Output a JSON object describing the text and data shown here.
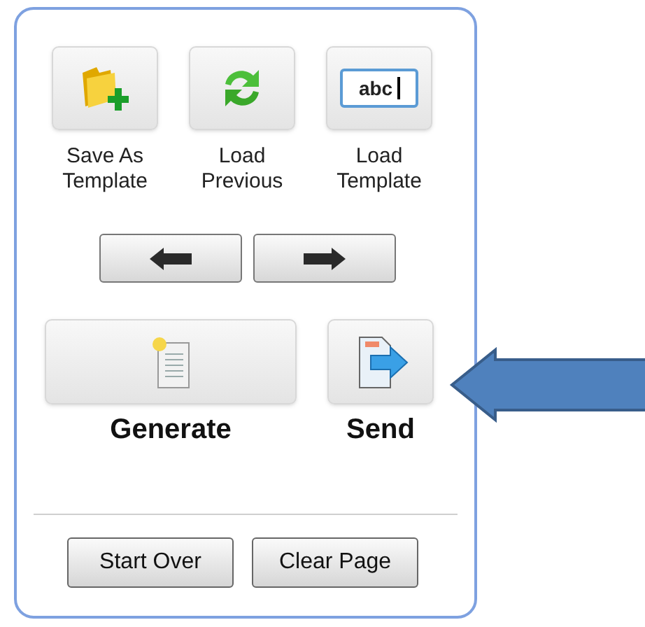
{
  "tiles": [
    {
      "kind": "folder",
      "label": "Save As Template"
    },
    {
      "kind": "reload",
      "label": "Load Previous"
    },
    {
      "kind": "textbox",
      "label": "Load Template",
      "field_text": "abc"
    }
  ],
  "actions": [
    {
      "kind": "generate",
      "label": "Generate"
    },
    {
      "kind": "send",
      "label": "Send"
    }
  ],
  "footer_buttons": [
    "Start Over",
    "Clear Page"
  ]
}
